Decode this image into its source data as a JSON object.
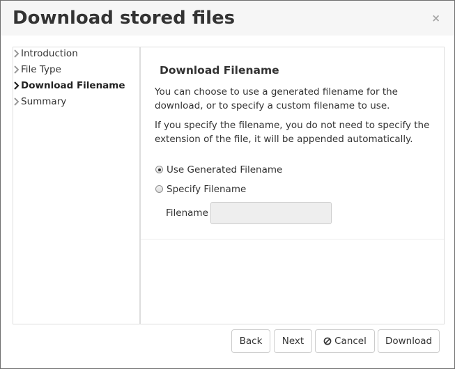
{
  "dialog": {
    "title": "Download stored files",
    "close_label": "×"
  },
  "steps": [
    {
      "label": "Introduction",
      "active": false
    },
    {
      "label": "File Type",
      "active": false
    },
    {
      "label": "Download Filename",
      "active": true
    },
    {
      "label": "Summary",
      "active": false
    }
  ],
  "content": {
    "section_title": "Download Filename",
    "paragraph_1": "You can choose to use a generated filename for the download, or to specify a custom filename to use.",
    "paragraph_2": "If you specify the filename, you do not need to specify the extension of the file, it will be appended automatically.",
    "options": [
      {
        "label": "Use Generated Filename",
        "checked": true
      },
      {
        "label": "Specify Filename",
        "checked": false
      }
    ],
    "filename_label": "Filename",
    "filename_value": "",
    "filename_disabled": true
  },
  "buttons": {
    "back": "Back",
    "next": "Next",
    "cancel": "Cancel",
    "download": "Download"
  },
  "icons": {
    "step_chevron": "chevron-right-icon",
    "cancel": "ban-icon",
    "close": "close-icon"
  },
  "colors": {
    "header_bg": "#f6f6f6",
    "border": "#dddddd",
    "text": "#333333",
    "input_disabled_bg": "#eeeeee",
    "close_icon": "#a6a6a6"
  }
}
